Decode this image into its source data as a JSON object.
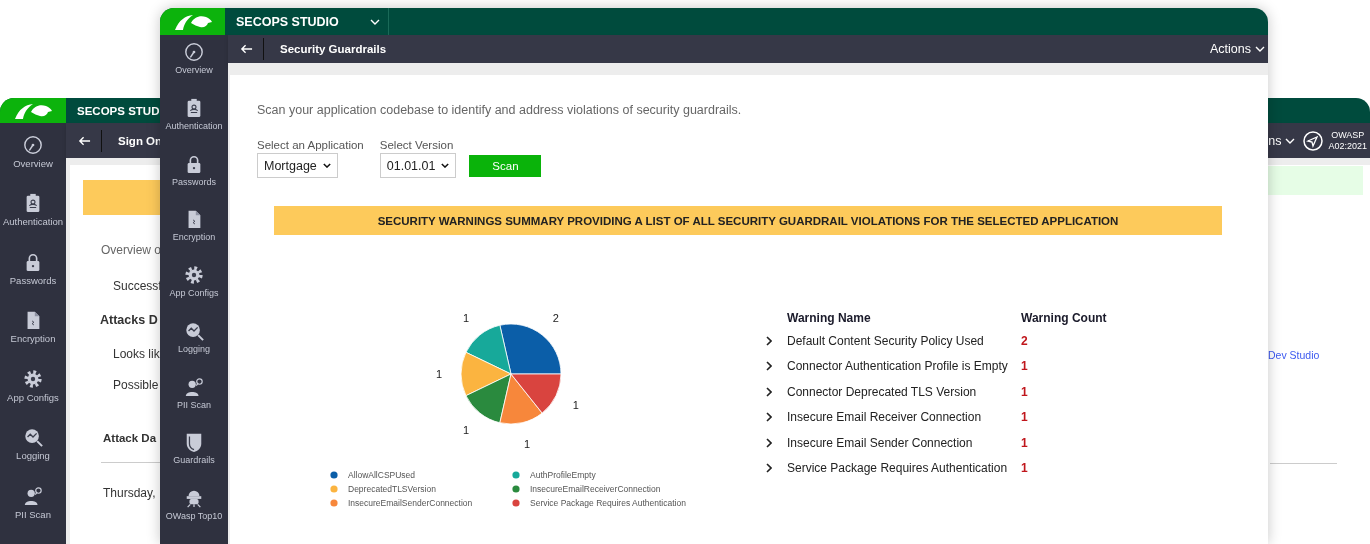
{
  "background_window": {
    "app_title": "SECOPS STUD",
    "page_title": "Sign On",
    "actions_label": "ns",
    "badge": {
      "title": "OWASP",
      "code": "A02:2021"
    },
    "sidebar": [
      {
        "label": "Overview",
        "kind": "gauge"
      },
      {
        "label": "Authentication",
        "kind": "badge"
      },
      {
        "label": "Passwords",
        "kind": "lock"
      },
      {
        "label": "Encryption",
        "kind": "document"
      },
      {
        "label": "App Configs",
        "kind": "gear"
      },
      {
        "label": "Logging",
        "kind": "chart"
      },
      {
        "label": "PII Scan",
        "kind": "person"
      }
    ],
    "left_content": [
      {
        "kind": "banner"
      },
      {
        "kind": "intro",
        "text": "Overview o"
      },
      {
        "kind": "item",
        "text": "Successf"
      },
      {
        "kind": "heading",
        "text": "Attacks D"
      },
      {
        "kind": "item",
        "text": "Looks lik"
      },
      {
        "kind": "item",
        "text": "Possible"
      },
      {
        "kind": "subheading",
        "text": "Attack Da"
      },
      {
        "kind": "rule"
      },
      {
        "kind": "item",
        "text": "Thursday,"
      }
    ],
    "right_content": [
      {
        "kind": "notice"
      },
      {
        "kind": "link",
        "text": "Dev Studio"
      },
      {
        "kind": "rule"
      }
    ]
  },
  "front_window": {
    "app_title": "SECOPS STUDIO",
    "page_title": "Security Guardrails",
    "actions_label": "Actions",
    "sidebar": [
      {
        "label": "Overview",
        "kind": "gauge"
      },
      {
        "label": "Authentication",
        "kind": "badge"
      },
      {
        "label": "Passwords",
        "kind": "lock"
      },
      {
        "label": "Encryption",
        "kind": "document"
      },
      {
        "label": "App Configs",
        "kind": "gear"
      },
      {
        "label": "Logging",
        "kind": "chart"
      },
      {
        "label": "PII Scan",
        "kind": "person"
      },
      {
        "label": "Guardrails",
        "kind": "shield"
      },
      {
        "label": "OWasp Top10",
        "kind": "robot"
      }
    ],
    "intro": "Scan your application codebase to identify and address violations of security guardrails.",
    "application": {
      "label": "Select an Application",
      "value": "Mortgage"
    },
    "version": {
      "label": "Select Version",
      "value": "01.01.01"
    },
    "scan_button": "Scan",
    "banner": "SECURITY WARNINGS SUMMARY PROVIDING A LIST OF ALL SECURITY GUARDRAIL VIOLATIONS FOR THE SELECTED APPLICATION",
    "chart_data": {
      "type": "pie",
      "categories": [
        "AllowAllCSPUsed",
        "AuthProfileEmpty",
        "DeprecatedTLSVersion",
        "InsecureEmailReceiverConnection",
        "InsecureEmailSenderConnection",
        "Service Package Requires Authentication"
      ],
      "values": [
        2,
        1,
        1,
        1,
        1,
        1
      ],
      "colors": [
        "#0b5ea8",
        "#17a99a",
        "#fbb440",
        "#2a8a3e",
        "#f7873b",
        "#d9443f"
      ],
      "data_labels": true,
      "legend": "bottom"
    },
    "table": {
      "columns": [
        "Warning Name",
        "Warning Count"
      ],
      "rows": [
        {
          "name": "Default Content Security Policy Used",
          "count": "2",
          "expanded": false
        },
        {
          "name": "Connector Authentication Profile is Empty",
          "count": "1",
          "expanded": false
        },
        {
          "name": "Connector Deprecated TLS Version",
          "count": "1",
          "expanded": false
        },
        {
          "name": "Insecure Email Receiver Connection",
          "count": "1",
          "expanded": false
        },
        {
          "name": "Insecure Email Sender Connection",
          "count": "1",
          "expanded": false
        },
        {
          "name": "Service Package Requires Authentication",
          "count": "1",
          "expanded": false
        }
      ]
    }
  }
}
